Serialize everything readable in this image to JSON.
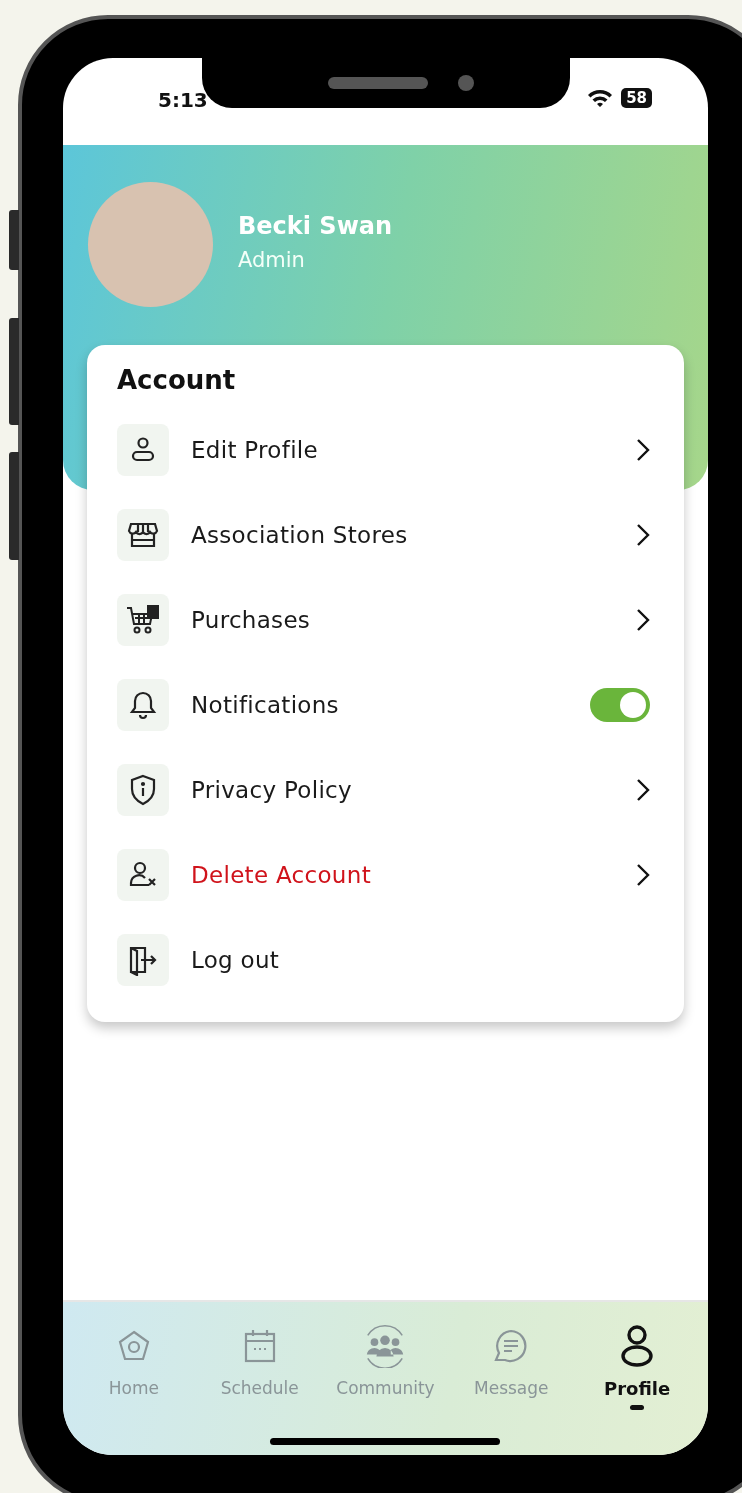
{
  "status_bar": {
    "time": "5:13",
    "battery": "58"
  },
  "profile": {
    "name": "Becki Swan",
    "role": "Admin"
  },
  "account": {
    "title": "Account",
    "items": [
      {
        "label": "Edit Profile",
        "kind": "link",
        "destructive": false
      },
      {
        "label": "Association Stores",
        "kind": "link",
        "destructive": false
      },
      {
        "label": "Purchases",
        "kind": "link",
        "destructive": false
      },
      {
        "label": "Notifications",
        "kind": "toggle",
        "on": true,
        "destructive": false
      },
      {
        "label": "Privacy Policy",
        "kind": "link",
        "destructive": false
      },
      {
        "label": "Delete Account",
        "kind": "link",
        "destructive": true
      },
      {
        "label": "Log out",
        "kind": "plain",
        "destructive": false
      }
    ]
  },
  "nav": [
    {
      "label": "Home",
      "selected": false
    },
    {
      "label": "Schedule",
      "selected": false
    },
    {
      "label": "Community",
      "selected": false
    },
    {
      "label": "Message",
      "selected": false
    },
    {
      "label": "Profile",
      "selected": true
    }
  ]
}
